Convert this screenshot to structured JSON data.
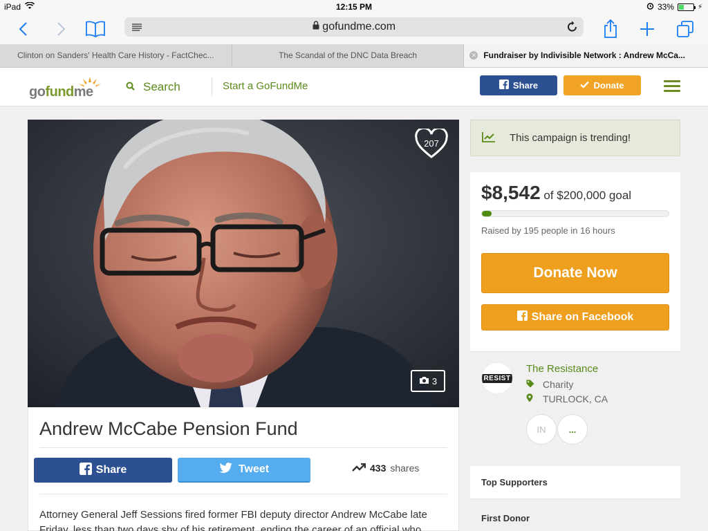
{
  "status_bar": {
    "device": "iPad",
    "time": "12:15 PM",
    "battery": "33%"
  },
  "browser": {
    "url": "gofundme.com",
    "tabs": [
      {
        "title": "Clinton on Sanders' Health Care History - FactChec..."
      },
      {
        "title": "The Scandal of the DNC Data Breach"
      },
      {
        "title": "Fundraiser by Indivisible Network : Andrew McCa..."
      }
    ]
  },
  "site_header": {
    "logo_text_a": "go",
    "logo_text_b": "fund",
    "logo_text_c": "me",
    "search_label": "Search",
    "start_label": "Start a GoFundMe",
    "share_label": "Share",
    "donate_label": "Donate"
  },
  "campaign": {
    "heart_count": "207",
    "photo_count": "3",
    "title": "Andrew McCabe Pension Fund",
    "share_label": "Share",
    "tweet_label": "Tweet",
    "shares_count": "433",
    "shares_label": "shares",
    "story": "Attorney General Jeff Sessions fired former FBI deputy director Andrew McCabe late Friday, less than two days shy of his retirement, ending the career of an official who"
  },
  "sidebar": {
    "trending_text": "This campaign is trending!",
    "amount": "$8,542",
    "goal_text": "of $200,000 goal",
    "progress_fraction": 0.043,
    "raised_text": "Raised by 195 people in 16 hours",
    "donate_now_label": "Donate Now",
    "share_facebook_label": "Share on Facebook",
    "organizer": {
      "name": "The Resistance",
      "avatar_text": "RESIST",
      "category": "Charity",
      "location": "TURLOCK, CA",
      "circle_1": "IN",
      "circle_2": "..."
    },
    "top_supporters_label": "Top Supporters",
    "first_donor_label": "First Donor"
  }
}
